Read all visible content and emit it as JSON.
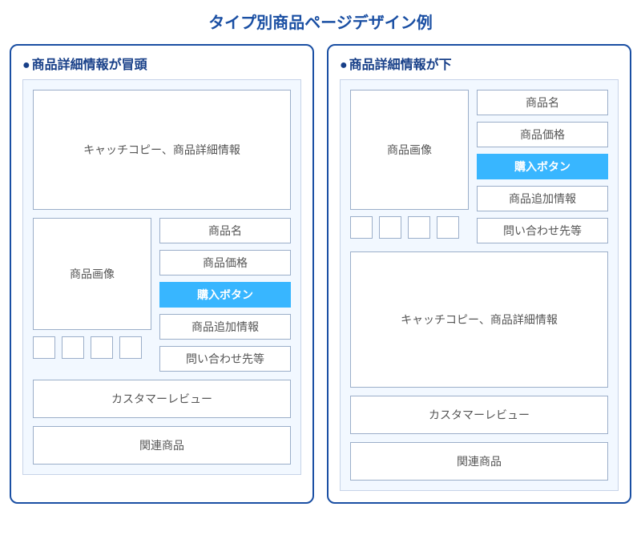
{
  "title": "タイプ別商品ページデザイン例",
  "panels": {
    "a": {
      "heading": "商品詳細情報が冒頭",
      "hero": "キャッチコピー、商品詳細情報",
      "product_image": "商品画像",
      "fields": {
        "name": "商品名",
        "price": "商品価格",
        "buy": "購入ボタン",
        "addl": "商品追加情報",
        "contact": "問い合わせ先等"
      },
      "reviews": "カスタマーレビュー",
      "related": "関連商品"
    },
    "b": {
      "heading": "商品詳細情報が下",
      "hero": "キャッチコピー、商品詳細情報",
      "product_image": "商品画像",
      "fields": {
        "name": "商品名",
        "price": "商品価格",
        "buy": "購入ボタン",
        "addl": "商品追加情報",
        "contact": "問い合わせ先等"
      },
      "reviews": "カスタマーレビュー",
      "related": "関連商品"
    }
  }
}
